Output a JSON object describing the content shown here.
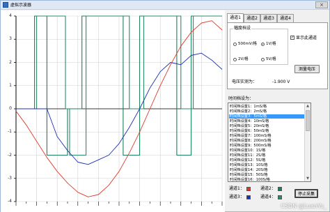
{
  "window": {
    "title": "虚拟示波器",
    "close_label": "×"
  },
  "colors": {
    "channel1": "#e0392b",
    "channel2": "#1a7f5e",
    "channel3": "#1c2fb6",
    "channel4": "#2a8a6a",
    "grid": "#d2d2d2",
    "axis": "#000000"
  },
  "chart_data": {
    "type": "line",
    "title": "",
    "xlabel": "",
    "ylabel": "",
    "ylim": [
      -4,
      4
    ],
    "yticks": [
      "4",
      "3",
      "2",
      "1",
      "0",
      "-1",
      "-2",
      "-3",
      "-4"
    ],
    "grid": true,
    "series": [
      {
        "name": "通道1",
        "shape": "sine",
        "amplitude": 3.8,
        "x": [
          0,
          0.05,
          0.1,
          0.15,
          0.2,
          0.25,
          0.3,
          0.35,
          0.4,
          0.45,
          0.5,
          0.55,
          0.6,
          0.65,
          0.7,
          0.75,
          0.8,
          0.85,
          0.9,
          0.95,
          1.0
        ],
        "y": [
          -0.1,
          -0.7,
          -1.4,
          -2.1,
          -2.7,
          -3.2,
          -3.6,
          -3.8,
          -3.7,
          -3.3,
          -2.7,
          -1.9,
          -1.0,
          0.0,
          1.0,
          1.9,
          2.7,
          3.3,
          3.7,
          3.8,
          3.4
        ]
      },
      {
        "name": "通道3",
        "shape": "clipped-sine",
        "x": [
          0,
          0.08,
          0.15,
          0.2,
          0.25,
          0.3,
          0.35,
          0.4,
          0.45,
          0.5,
          0.55,
          0.6,
          0.65,
          0.7,
          0.75,
          0.8,
          0.85,
          0.9,
          0.95,
          1.0
        ],
        "y": [
          0,
          0,
          0,
          -1.2,
          -1.8,
          -2.3,
          -2.4,
          -2.2,
          -2.0,
          -1.5,
          -0.8,
          0.0,
          0.9,
          1.6,
          2.0,
          1.9,
          2.3,
          2.4,
          2.1,
          1.7
        ]
      },
      {
        "name": "通道2",
        "shape": "square",
        "x": [
          0,
          0.09,
          0.09,
          0.15,
          0.15,
          0.25,
          0.25,
          0.32,
          0.32,
          0.52,
          0.52,
          0.6,
          0.6,
          0.78,
          0.78,
          0.85,
          0.85,
          1.0
        ],
        "y": [
          0,
          0,
          4,
          4,
          -2,
          -2,
          0,
          0,
          4,
          4,
          -2,
          -2,
          4,
          4,
          -2,
          -2,
          4,
          4
        ]
      },
      {
        "name": "通道4",
        "shape": "square",
        "x": [
          0,
          0.1,
          0.1,
          0.24,
          0.24,
          0.26,
          0.26,
          0.34,
          0.34,
          0.55,
          0.55,
          0.62,
          0.62,
          0.8,
          0.8,
          0.86,
          0.86,
          1.0
        ],
        "y": [
          0,
          0,
          4,
          4,
          0,
          0,
          -2,
          -2,
          4,
          4,
          0,
          0,
          4,
          4,
          0,
          0,
          4,
          4
        ]
      }
    ]
  },
  "tabs": [
    {
      "label": "通道1"
    },
    {
      "label": "通道2"
    },
    {
      "label": "通道3"
    },
    {
      "label": "通道4"
    }
  ],
  "channel_panel": {
    "group_title": "幅度档设",
    "radios": [
      {
        "label": "500mV/格",
        "checked": false
      },
      {
        "label": "1V/格",
        "checked": true
      },
      {
        "label": "2V/格",
        "checked": false
      },
      {
        "label": "5V/格",
        "checked": false
      }
    ],
    "show_waveform_label": "显示此通道",
    "show_waveform_checked": true,
    "measure_button": "测量电压",
    "voltage_label": "电压实测为：",
    "voltage_value": "-1.900 V"
  },
  "timebase": {
    "label": "时间档设为：",
    "items": [
      "时间档设置1：1mS/格",
      "时间档设置2：2mS/格",
      "时间档设置3：5mS/格",
      "时间档设置4：10mS/格",
      "时间档设置5：20mS/格",
      "时间档设置6：50mS/格",
      "时间档设置7：100mS/格",
      "时间档设置8：200mS/格",
      "时间档设置9：500mS/格",
      "时间档设置10：1S/格",
      "时间档设置11：2S/格",
      "时间档设置12：5S/格",
      "时间档设置13：10S/格",
      "时间档设置14：20S/格",
      "时间档设置15：50S/格",
      "时间档设置16：100S/格"
    ],
    "selected_index": 2
  },
  "legend": [
    {
      "label": "通道1：",
      "color": "#e0392b"
    },
    {
      "label": "通道2：",
      "color": "#1a7f5e"
    },
    {
      "label": "通道3：",
      "color": "#1c2fb6"
    },
    {
      "label": "通道4：",
      "color": "#2a8a6a"
    }
  ],
  "stop_button": "停止采集",
  "watermark": "CSDN @LuanYu_"
}
